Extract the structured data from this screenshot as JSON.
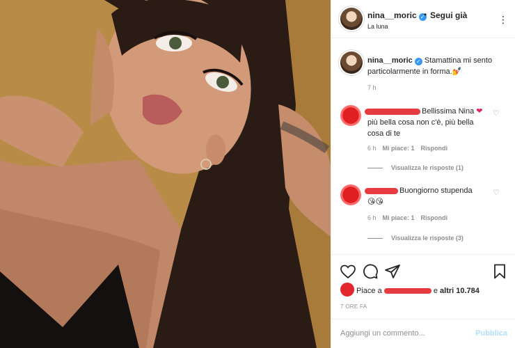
{
  "header": {
    "username": "nina__moric",
    "verified_mark": "✓",
    "separator": "•",
    "follow_label": "Segui già",
    "location": "La luna",
    "more_icon": "⋮"
  },
  "caption": {
    "username": "nina__moric",
    "text": "Stamattina mi sento particolarmente in forma.",
    "emoji": "💅",
    "time": "7 h"
  },
  "comments": [
    {
      "text": "Bellissima Nina",
      "emoji": "❤",
      "text2": "più bella cosa non c'è, più bella cosa di te",
      "time": "6 h",
      "likes": "Mi piace: 1",
      "reply": "Rispondi",
      "view_replies": "Visualizza le risposte (1)"
    },
    {
      "text": "Buongiorno stupenda",
      "emoji": "😘😘",
      "time": "6 h",
      "likes": "Mi piace: 1",
      "reply": "Rispondi",
      "view_replies": "Visualizza le risposte (3)"
    }
  ],
  "likes": {
    "prefix": "Piace a",
    "suffix": "e",
    "others": "altri 10.784"
  },
  "posted_ago": "7 ORE FA",
  "add_comment": {
    "placeholder": "Aggiungi un commento...",
    "publish_label": "Pubblica"
  },
  "colors": {
    "verified": "#3897f0",
    "publish_disabled": "#b2dffc",
    "redaction": "#e3262b",
    "heart": "#e0245e"
  }
}
